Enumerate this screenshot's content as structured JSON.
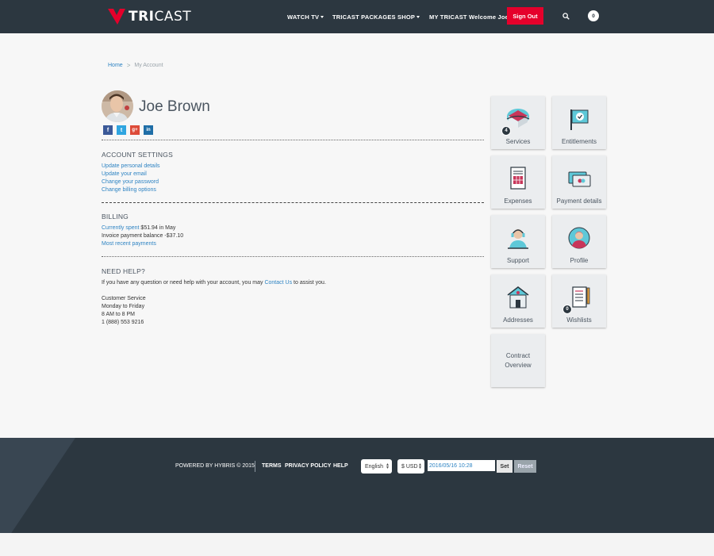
{
  "header": {
    "logo_bold": "TRI",
    "logo_light": "CAST",
    "nav": {
      "watch_tv": "WATCH TV",
      "packages": "TRICAST PACKAGES",
      "shop": "SHOP",
      "my_tricast": "MY TRICAST",
      "welcome": "Welcome Joe"
    },
    "sign_out": "Sign Out",
    "cart_count": "0",
    "accent_color": "#e5002b",
    "bar_color": "#2c3740"
  },
  "breadcrumb": {
    "home": "Home",
    "separator": ">",
    "current": "My Account"
  },
  "profile": {
    "name": "Joe Brown",
    "socials": [
      {
        "icon": "facebook-icon",
        "glyph": "f",
        "color": "#3b5998"
      },
      {
        "icon": "twitter-icon",
        "glyph": "t",
        "color": "#2fa5e0"
      },
      {
        "icon": "google-plus-icon",
        "glyph": "g+",
        "color": "#dd4b39"
      },
      {
        "icon": "linkedin-icon",
        "glyph": "in",
        "color": "#1f6ea7"
      }
    ]
  },
  "account_settings": {
    "title": "ACCOUNT SETTINGS",
    "links": [
      "Update personal details",
      "Update your email",
      "Change your password",
      "Change billing options"
    ]
  },
  "billing": {
    "title": "BILLING",
    "currently_spent_label": "Currently spent",
    "currently_spent_value": "$51.94  in  May",
    "invoice_balance": "Invoice payment balance -$37.10",
    "recent_payments": "Most recent payments"
  },
  "help": {
    "title": "NEED HELP?",
    "text_before": "If you have any question or need help with your account, you may ",
    "contact_link": "Contact Us",
    "text_after": " to assist you.",
    "service_lines": [
      "Customer Service",
      "Monday to Friday",
      "8 AM to 8 PM",
      "1 (888) 553 9216"
    ]
  },
  "tiles": [
    {
      "label": "Services",
      "icon": "services-icon",
      "badge": "4"
    },
    {
      "label": "Entitlements",
      "icon": "entitlements-flag-icon",
      "badge": ""
    },
    {
      "label": "Expenses",
      "icon": "expenses-document-icon",
      "badge": ""
    },
    {
      "label": "Payment details",
      "icon": "payment-cards-icon",
      "badge": ""
    },
    {
      "label": "Support",
      "icon": "support-headset-icon",
      "badge": ""
    },
    {
      "label": "Profile",
      "icon": "profile-user-icon",
      "badge": ""
    },
    {
      "label": "Addresses",
      "icon": "addresses-house-icon",
      "badge": ""
    },
    {
      "label": "Wishlists",
      "icon": "wishlists-clipboard-icon",
      "badge": "0"
    },
    {
      "label": "Contract\nOverview",
      "icon": "",
      "badge": ""
    }
  ],
  "contract_overview": {
    "line1": "Contract",
    "line2": "Overview"
  },
  "footer": {
    "powered_by": "POWERED BY HYBRIS © 2015",
    "terms": "TERMS",
    "privacy": "PRIVACY POLICY",
    "help": "HELP",
    "language": "English",
    "currency": "$ USD",
    "date_value": "2016/05/16 10:28",
    "set": "Set",
    "reset": "Reset"
  }
}
